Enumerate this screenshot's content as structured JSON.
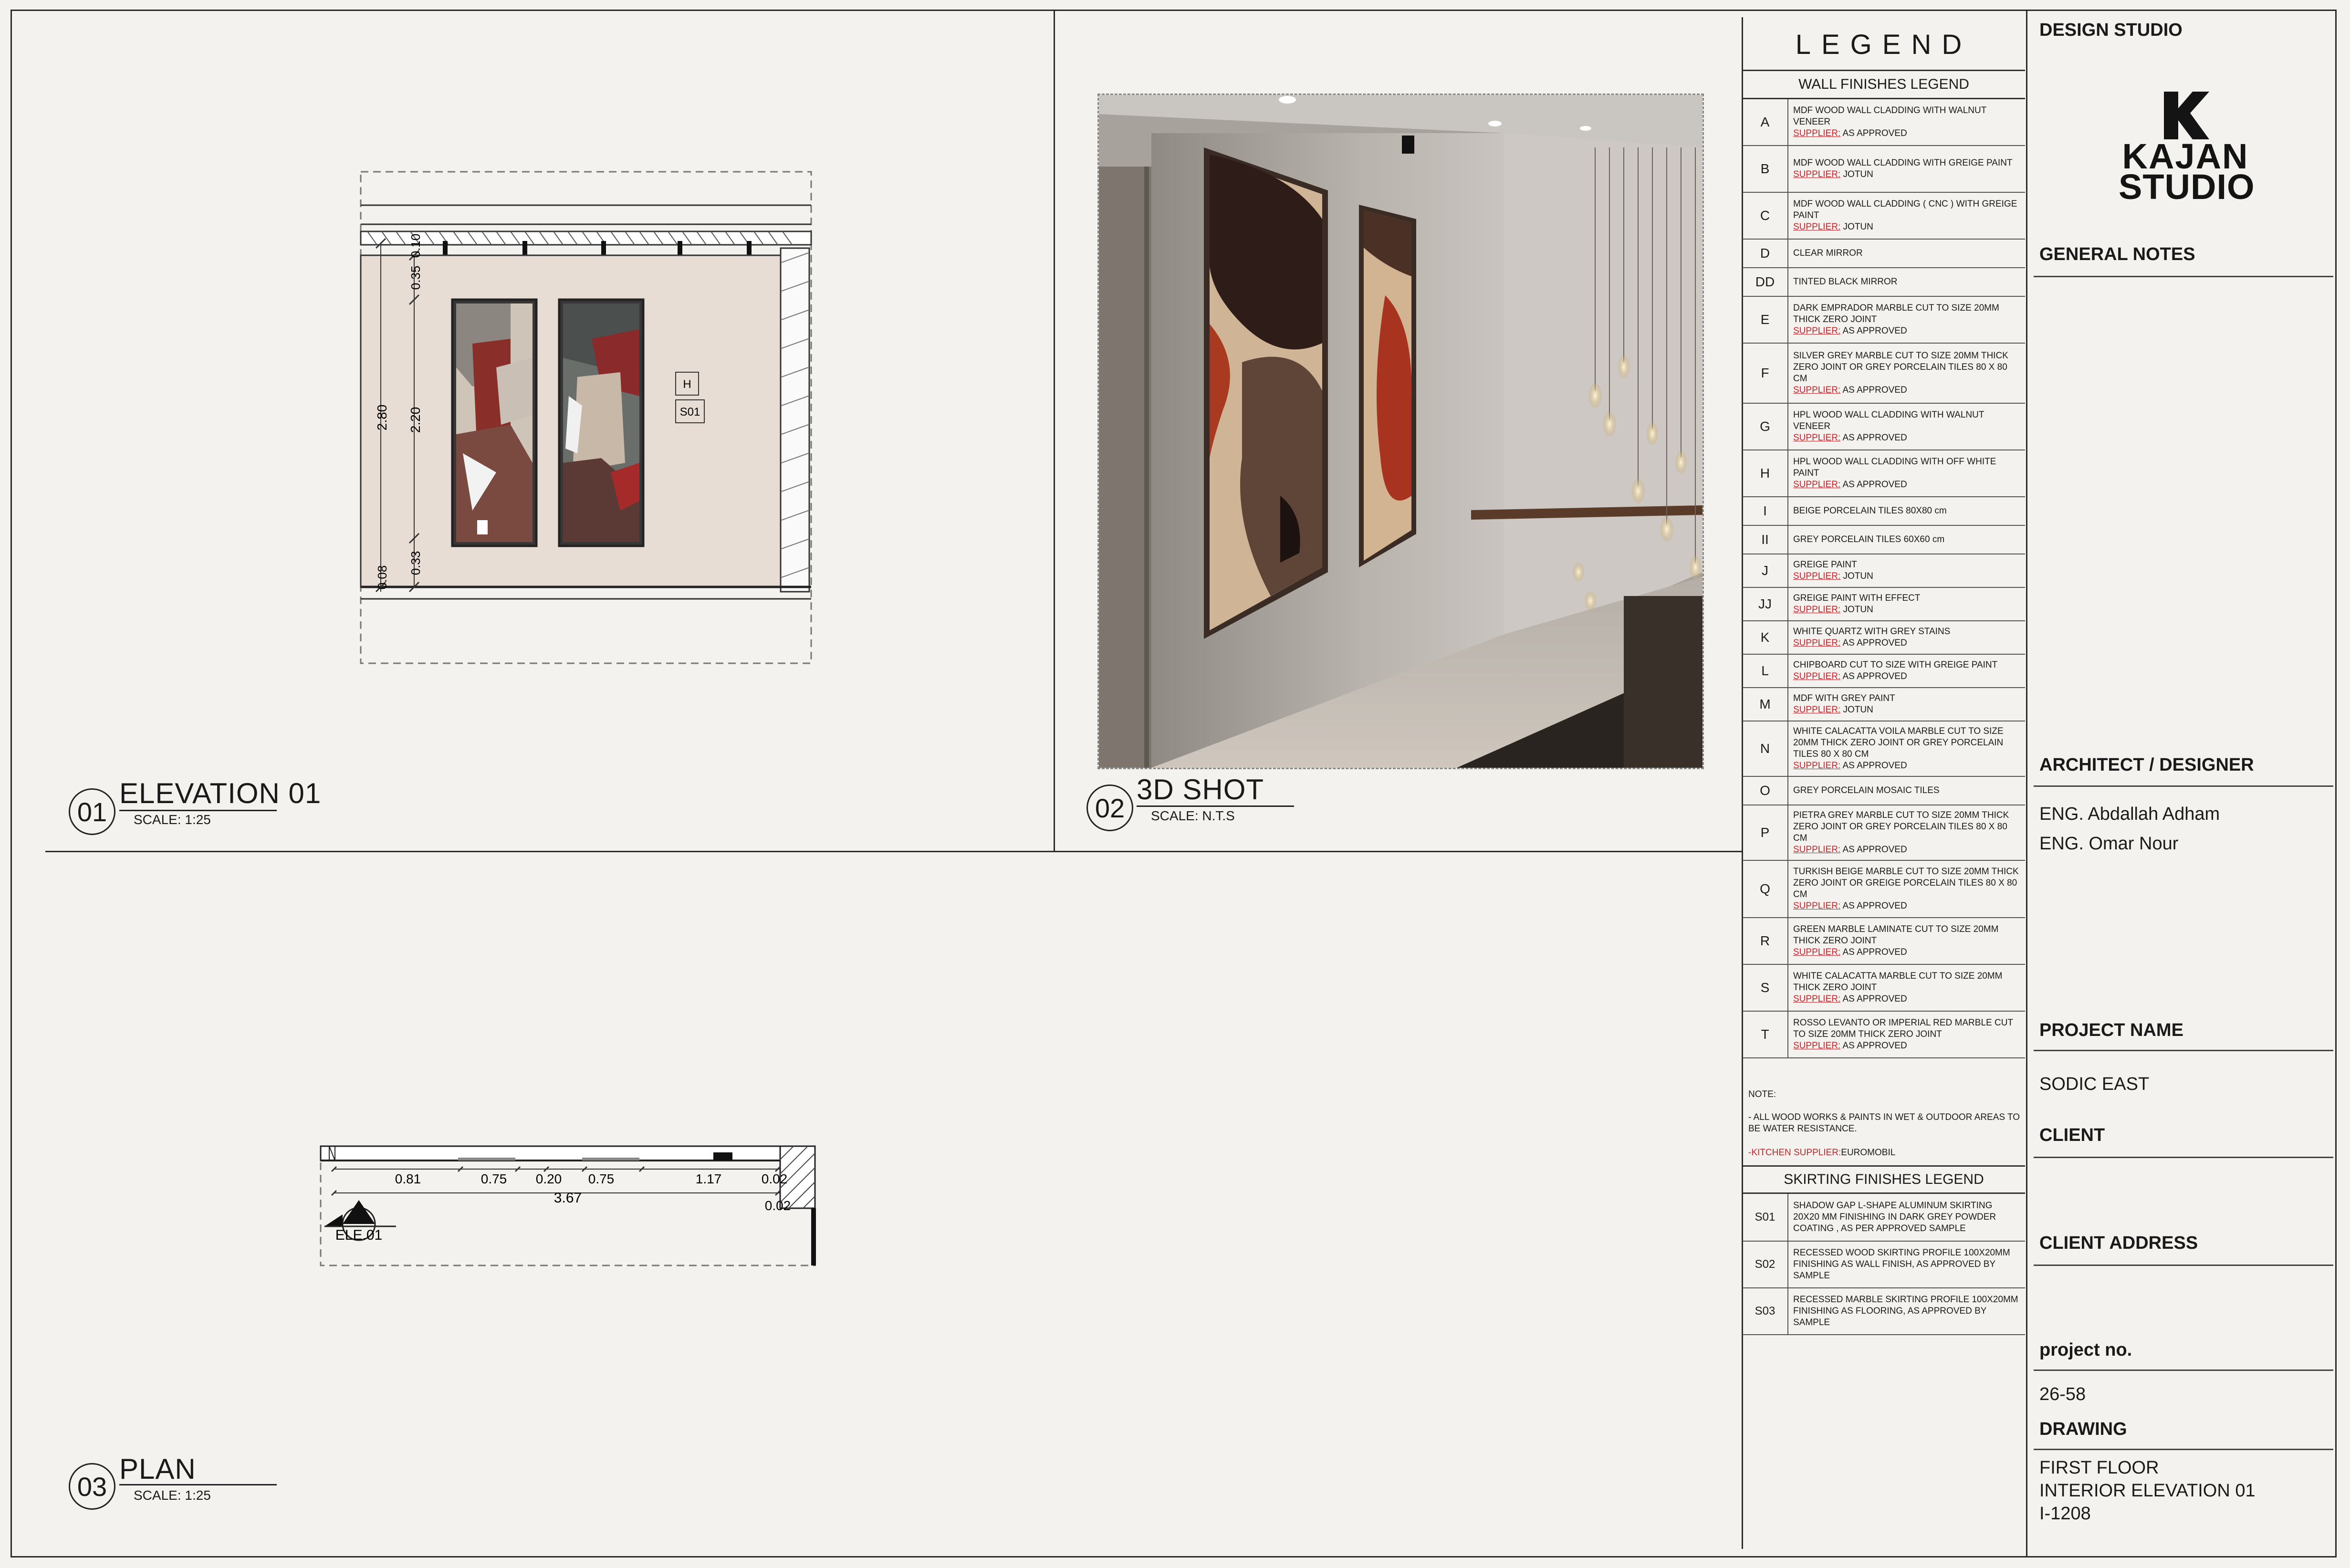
{
  "views": [
    {
      "number": "01",
      "title": "ELEVATION 01",
      "scale": "SCALE: 1:25"
    },
    {
      "number": "02",
      "title": "3D SHOT",
      "scale": "SCALE: N.T.S"
    },
    {
      "number": "03",
      "title": "PLAN",
      "scale": "SCALE: 1:25"
    }
  ],
  "elevation": {
    "dims_left": [
      "2.80",
      "0.08"
    ],
    "dims_inner": [
      "0.35",
      "0.10",
      "2.20",
      "0.33"
    ],
    "tags": [
      "H",
      "S01"
    ]
  },
  "plan": {
    "dims_top": [
      "0.81",
      "0.75",
      "0.20",
      "0.75",
      "1.17",
      "0.02"
    ],
    "total": "3.67",
    "dim_right": "0.02",
    "section_marker": "ELE.01"
  },
  "legend": {
    "title": "LEGEND",
    "wall_heading": "WALL FINISHES LEGEND",
    "supplier_label": "SUPPLIER:",
    "wall_items": [
      {
        "code": "A",
        "text": "MDF WOOD WALL CLADDING WITH WALNUT VENEER",
        "supplier": "AS APPROVED"
      },
      {
        "code": "B",
        "text": "MDF WOOD WALL CLADDING WITH  GREIGE PAINT",
        "supplier": "JOTUN"
      },
      {
        "code": "C",
        "text": "MDF WOOD WALL CLADDING ( CNC ) WITH GREIGE PAINT",
        "supplier": "JOTUN"
      },
      {
        "code": "D",
        "text": "CLEAR MIRROR",
        "supplier": ""
      },
      {
        "code": "DD",
        "text": "TINTED BLACK MIRROR",
        "supplier": ""
      },
      {
        "code": "E",
        "text": "DARK EMPRADOR MARBLE CUT TO SIZE 20MM THICK ZERO JOINT",
        "supplier": "AS APPROVED"
      },
      {
        "code": "F",
        "text": "SILVER GREY MARBLE CUT TO SIZE 20MM THICK ZERO JOINT OR GREY PORCELAIN TILES 80 X 80 CM",
        "supplier": "AS APPROVED"
      },
      {
        "code": "G",
        "text": "HPL WOOD WALL CLADDING WITH WALNUT VENEER",
        "supplier": "AS APPROVED"
      },
      {
        "code": "H",
        "text": "HPL WOOD WALL CLADDING WITH OFF WHITE PAINT",
        "supplier": "AS APPROVED"
      },
      {
        "code": "I",
        "text": "BEIGE PORCELAIN TILES  80X80 cm",
        "supplier": ""
      },
      {
        "code": "II",
        "text": "GREY PORCELAIN TILES  60X60 cm",
        "supplier": ""
      },
      {
        "code": "J",
        "text": "GREIGE PAINT",
        "supplier": "JOTUN"
      },
      {
        "code": "JJ",
        "text": "GREIGE PAINT WITH EFFECT",
        "supplier": "JOTUN"
      },
      {
        "code": "K",
        "text": "WHITE QUARTZ WITH GREY STAINS",
        "supplier": "AS APPROVED"
      },
      {
        "code": "L",
        "text": "CHIPBOARD  CUT TO SIZE WITH GREIGE PAINT",
        "supplier": "AS APPROVED"
      },
      {
        "code": "M",
        "text": "MDF WITH GREY PAINT",
        "supplier": "JOTUN"
      },
      {
        "code": "N",
        "text": "WHITE CALACATTA VOILA MARBLE CUT TO SIZE 20MM THICK ZERO JOINT OR GREY PORCELAIN TILES 80 X 80 CM",
        "supplier": "AS APPROVED"
      },
      {
        "code": "O",
        "text": "GREY PORCELAIN MOSAIC TILES",
        "supplier": ""
      },
      {
        "code": "P",
        "text": "PIETRA GREY  MARBLE CUT TO SIZE 20MM THICK ZERO JOINT OR GREY PORCELAIN TILES 80 X 80 CM",
        "supplier": "AS APPROVED"
      },
      {
        "code": "Q",
        "text": "TURKISH BEIGE MARBLE CUT TO SIZE 20MM THICK ZERO JOINT OR GREIGE PORCELAIN TILES 80 X 80 CM",
        "supplier": "AS APPROVED"
      },
      {
        "code": "R",
        "text": "GREEN MARBLE LAMINATE CUT TO SIZE 20MM THICK ZERO JOINT",
        "supplier": "AS APPROVED"
      },
      {
        "code": "S",
        "text": "WHITE CALACATTA MARBLE CUT TO SIZE 20MM THICK ZERO JOINT",
        "supplier": "AS APPROVED"
      },
      {
        "code": "T",
        "text": "ROSSO LEVANTO OR IMPERIAL RED MARBLE CUT TO SIZE 20MM THICK ZERO JOINT",
        "supplier": "AS APPROVED"
      }
    ],
    "note_label": "NOTE:",
    "note_text": "- ALL WOOD WORKS & PAINTS IN WET & OUTDOOR AREAS TO BE WATER RESISTANCE.",
    "kitchen_label": "-KITCHEN SUPPLIER:",
    "kitchen_value": "EUROMOBIL",
    "skirting_heading": "SKIRTING FINISHES LEGEND",
    "skirting_items": [
      {
        "code": "S01",
        "text": "SHADOW GAP L-SHAPE ALUMINUM SKIRTING 20X20 MM FINISHING IN DARK GREY POWDER COATING , AS PER APPROVED SAMPLE"
      },
      {
        "code": "S02",
        "text": "RECESSED WOOD SKIRTING PROFILE 100X20MM FINISHING AS WALL FINISH, AS APPROVED BY SAMPLE"
      },
      {
        "code": "S03",
        "text": "RECESSED MARBLE SKIRTING PROFILE 100X20MM FINISHING AS FLOORING, AS APPROVED BY SAMPLE"
      }
    ]
  },
  "title_block": {
    "design_studio": "DESIGN STUDIO",
    "logo_line1": "KAJAN",
    "logo_line2": "STUDIO",
    "general_notes": "GENERAL NOTES",
    "architect_label": "ARCHITECT / DESIGNER",
    "architects": [
      "ENG. Abdallah Adham",
      "ENG. Omar Nour"
    ],
    "project_name_label": "PROJECT NAME",
    "project_name": "SODIC EAST",
    "client_label": "CLIENT",
    "client_address_label": "CLIENT ADDRESS",
    "project_no_label": "project no.",
    "project_no": "26-58",
    "drawing_label": "DRAWING",
    "drawing_lines": [
      "FIRST FLOOR",
      "INTERIOR ELEVATION 01",
      "I-1208"
    ]
  },
  "colors": {
    "paper": "#f3f2ee",
    "wall": "#e8ddd4",
    "accent_red": "#c0282d"
  }
}
